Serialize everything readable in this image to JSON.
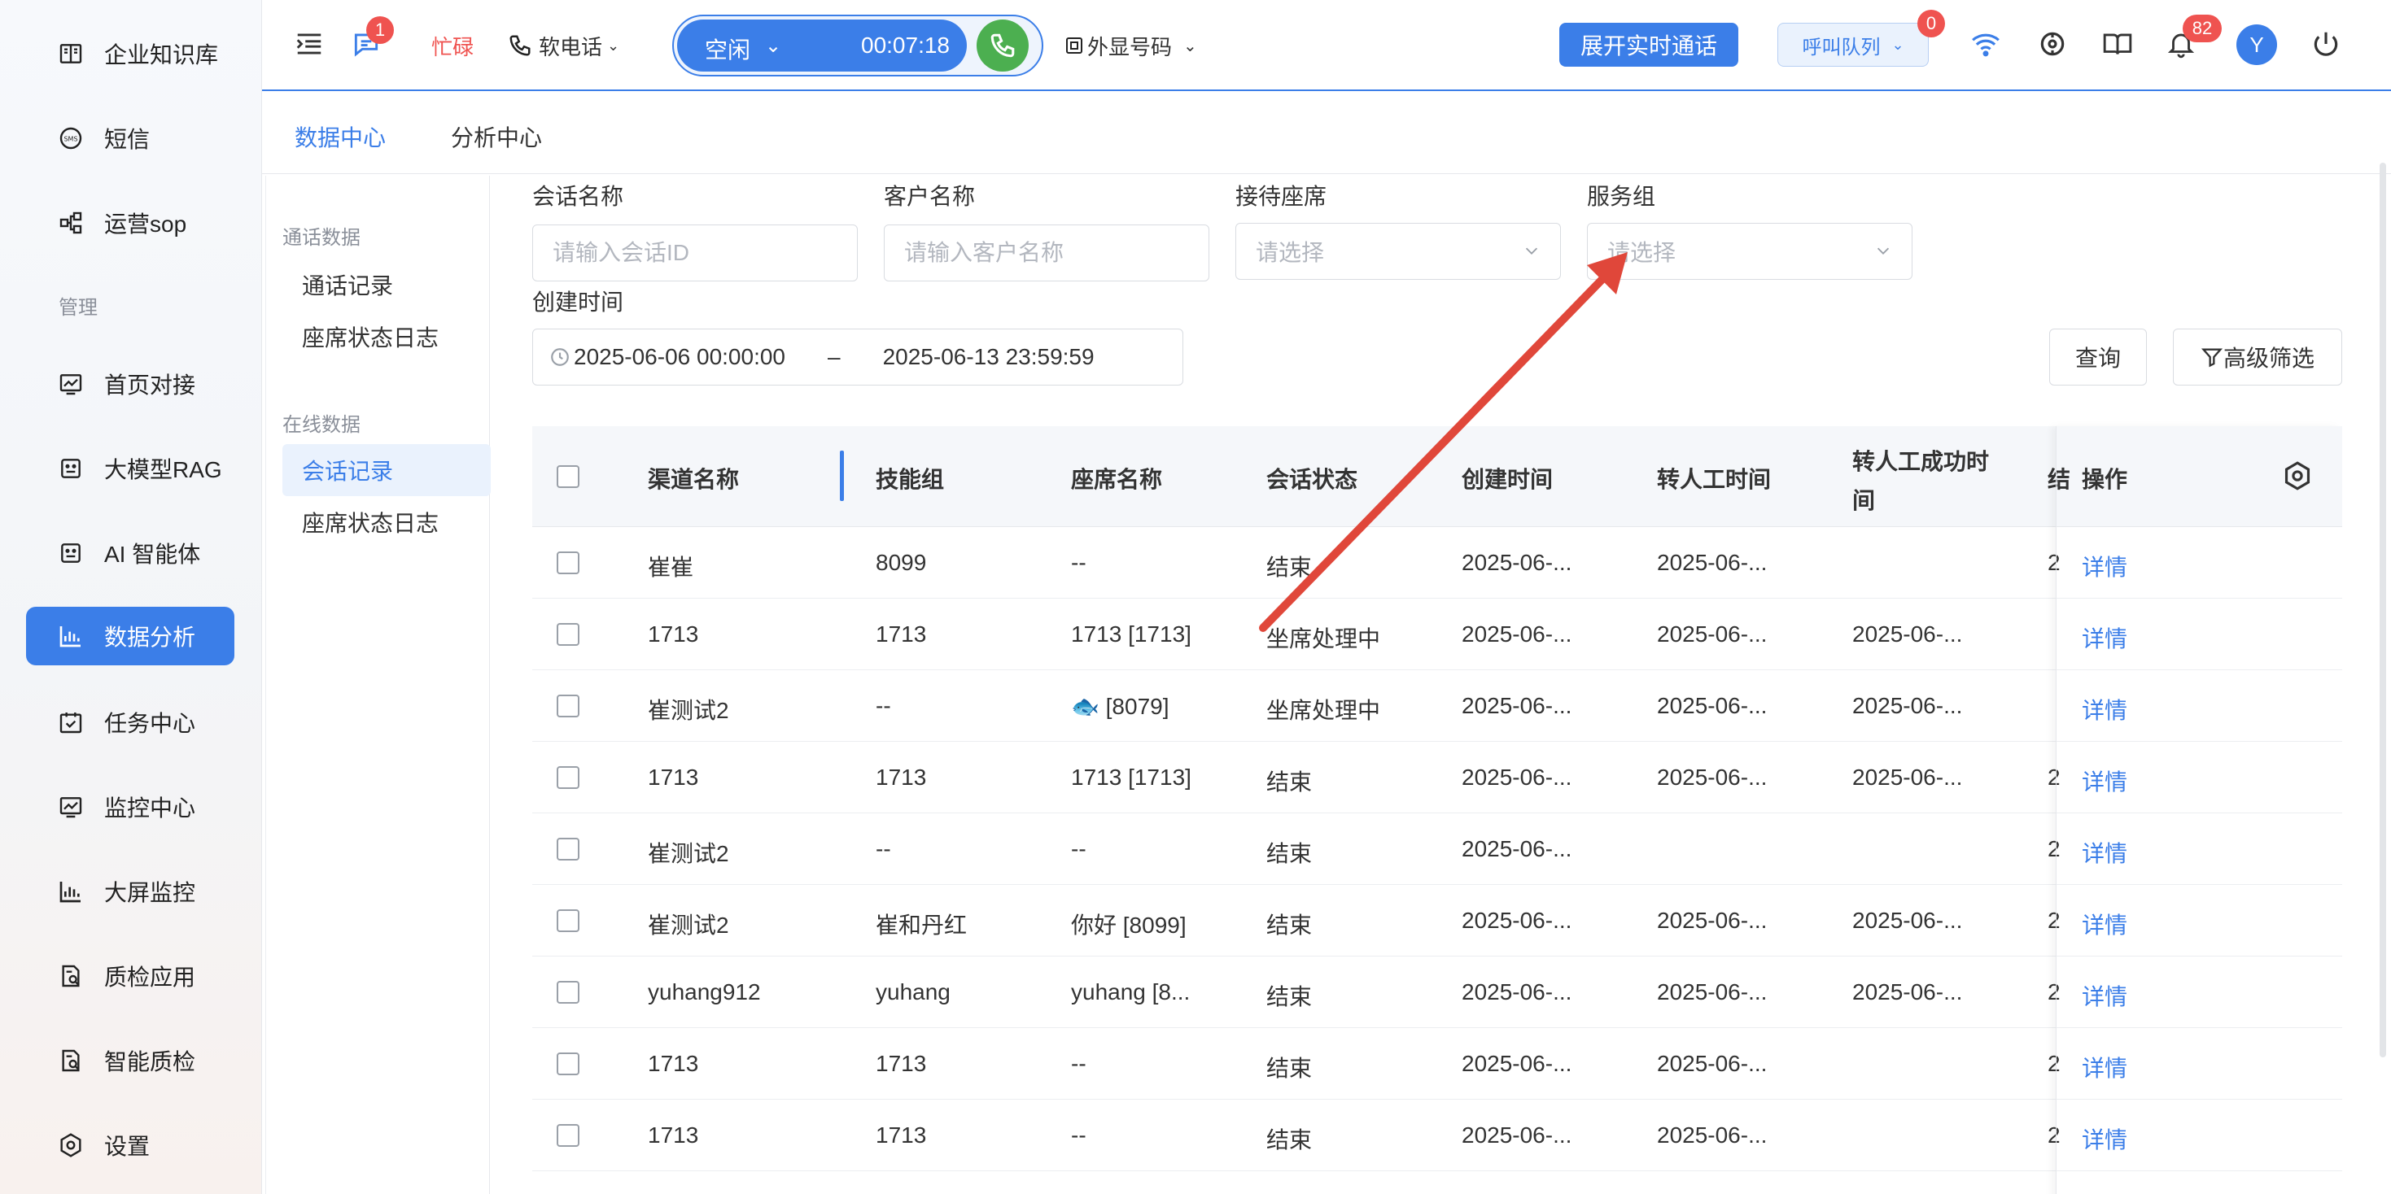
{
  "sidebar": {
    "items": [
      {
        "label": "企业知识库",
        "icon": "book-icon"
      },
      {
        "label": "短信",
        "icon": "sms-icon"
      },
      {
        "label": "运营sop",
        "icon": "flow-icon"
      },
      {
        "label": "首页对接",
        "icon": "chart-line-icon"
      },
      {
        "label": "大模型RAG",
        "icon": "robot-icon"
      },
      {
        "label": "AI 智能体",
        "icon": "robot-icon"
      },
      {
        "label": "数据分析",
        "icon": "bar-chart-icon"
      },
      {
        "label": "任务中心",
        "icon": "calendar-check-icon"
      },
      {
        "label": "监控中心",
        "icon": "chart-line-icon"
      },
      {
        "label": "大屏监控",
        "icon": "bar-chart-icon"
      },
      {
        "label": "质检应用",
        "icon": "doc-check-icon"
      },
      {
        "label": "智能质检",
        "icon": "doc-check-icon"
      },
      {
        "label": "设置",
        "icon": "gear-icon"
      }
    ],
    "section_manage": "管理",
    "active_index": 6
  },
  "topbar": {
    "chat_badge": "1",
    "busy_label": "忙碌",
    "phone_label": "软电话",
    "status_label": "空闲",
    "timer": "00:07:18",
    "outbound_label": "外显号码",
    "realtime_button": "展开实时通话",
    "queue_label": "呼叫队列",
    "queue_badge": "0",
    "bell_badge": "82",
    "avatar_letter": "Y",
    "accent": "#3b7ee8"
  },
  "tabs": {
    "data_center": "数据中心",
    "analysis_center": "分析中心"
  },
  "subnav": {
    "call_data_title": "通话数据",
    "call_records": "通话记录",
    "seat_log_1": "座席状态日志",
    "online_data_title": "在线数据",
    "session_records": "会话记录",
    "seat_log_2": "座席状态日志"
  },
  "filters": {
    "session_name_label": "会话名称",
    "session_name_placeholder": "请输入会话ID",
    "customer_name_label": "客户名称",
    "customer_name_placeholder": "请输入客户名称",
    "seat_label": "接待座席",
    "seat_placeholder": "请选择",
    "group_label": "服务组",
    "group_placeholder": "请选择",
    "created_label": "创建时间",
    "date_start": "2025-06-06 00:00:00",
    "date_sep": "–",
    "date_end": "2025-06-13 23:59:59",
    "query_button": "查询",
    "advanced_button": "高级筛选"
  },
  "table": {
    "headers": {
      "channel": "渠道名称",
      "skill": "技能组",
      "seat": "座席名称",
      "status": "会话状态",
      "created": "创建时间",
      "transfer": "转人工时间",
      "transfer_ok_1": "转人工成功时",
      "transfer_ok_2": "间",
      "cut": "结",
      "action": "操作"
    },
    "rows": [
      {
        "channel": "崔崔",
        "skill": "8099",
        "seat": "--",
        "status": "结束",
        "created": "2025-06-...",
        "transfer": "2025-06-...",
        "transfer_ok": "",
        "cut": "2",
        "action": "详情"
      },
      {
        "channel": "1713",
        "skill": "1713",
        "seat": "1713 [1713]",
        "status": "坐席处理中",
        "created": "2025-06-...",
        "transfer": "2025-06-...",
        "transfer_ok": "2025-06-...",
        "cut": "",
        "action": "详情"
      },
      {
        "channel": "崔测试2",
        "skill": "--",
        "seat": "🐟 [8079]",
        "status": "坐席处理中",
        "created": "2025-06-...",
        "transfer": "2025-06-...",
        "transfer_ok": "2025-06-...",
        "cut": "",
        "action": "详情"
      },
      {
        "channel": "1713",
        "skill": "1713",
        "seat": "1713 [1713]",
        "status": "结束",
        "created": "2025-06-...",
        "transfer": "2025-06-...",
        "transfer_ok": "2025-06-...",
        "cut": "2",
        "action": "详情"
      },
      {
        "channel": "崔测试2",
        "skill": "--",
        "seat": "--",
        "status": "结束",
        "created": "2025-06-...",
        "transfer": "",
        "transfer_ok": "",
        "cut": "2",
        "action": "详情"
      },
      {
        "channel": "崔测试2",
        "skill": "崔和丹红",
        "seat": "你好 [8099]",
        "status": "结束",
        "created": "2025-06-...",
        "transfer": "2025-06-...",
        "transfer_ok": "2025-06-...",
        "cut": "2",
        "action": "详情"
      },
      {
        "channel": "yuhang912",
        "skill": "yuhang",
        "seat": "yuhang [8...",
        "status": "结束",
        "created": "2025-06-...",
        "transfer": "2025-06-...",
        "transfer_ok": "2025-06-...",
        "cut": "2",
        "action": "详情"
      },
      {
        "channel": "1713",
        "skill": "1713",
        "seat": "--",
        "status": "结束",
        "created": "2025-06-...",
        "transfer": "2025-06-...",
        "transfer_ok": "",
        "cut": "2",
        "action": "详情"
      },
      {
        "channel": "1713",
        "skill": "1713",
        "seat": "--",
        "status": "结束",
        "created": "2025-06-...",
        "transfer": "2025-06-...",
        "transfer_ok": "",
        "cut": "2",
        "action": "详情"
      }
    ]
  },
  "annotation": {
    "arrow_color": "#e0473a"
  }
}
